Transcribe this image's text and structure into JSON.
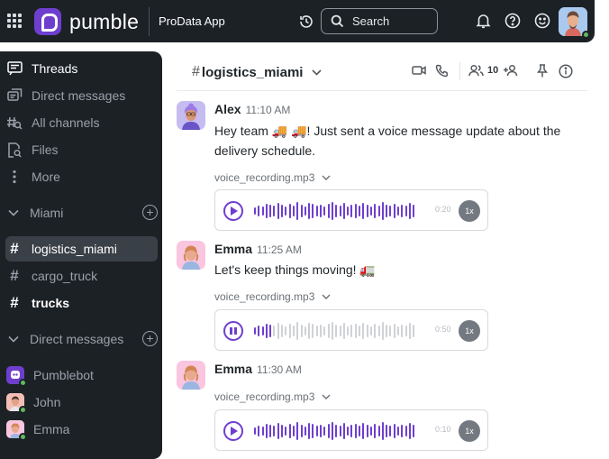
{
  "topbar": {
    "brand": "pumble",
    "workspace": "ProData App",
    "search_placeholder": "Search"
  },
  "sidebar": {
    "top_items": [
      {
        "label": "Threads",
        "icon": "threads-icon"
      },
      {
        "label": "Direct messages",
        "icon": "direct-messages-icon"
      },
      {
        "label": "All channels",
        "icon": "all-channels-icon"
      },
      {
        "label": "Files",
        "icon": "files-icon"
      },
      {
        "label": "More",
        "icon": "more-icon"
      }
    ],
    "channel_section": "Miami",
    "channels": [
      "logistics_miami",
      "cargo_truck",
      "trucks"
    ],
    "dm_section": "Direct messages",
    "dms": [
      "Pumblebot",
      "John",
      "Emma"
    ]
  },
  "channel": {
    "name": "logistics_miami",
    "member_count": "10"
  },
  "messages": [
    {
      "author": "Alex",
      "time": "11:10 AM",
      "text_line1": "Hey team 🚚 🚚! Just sent a voice message update about the",
      "text_line2": "delivery schedule.",
      "file": "voice_recording.mp3",
      "duration": "0:20",
      "speed": "1x",
      "state": "paused",
      "progress": 0
    },
    {
      "author": "Emma",
      "time": "11:25 AM",
      "text_line1": "Let's keep things moving! 🚛",
      "file": "voice_recording.mp3",
      "duration": "0:50",
      "speed": "1x",
      "state": "playing",
      "progress": 0.13
    },
    {
      "author": "Emma",
      "time": "11:30 AM",
      "file": "voice_recording.mp3",
      "duration": "0:10",
      "speed": "1x",
      "state": "paused",
      "progress": 0
    }
  ],
  "colors": {
    "brand": "#6e3fce",
    "dark_bg": "#1c2126",
    "online": "#62b95f",
    "waveform_unplayed": "#cfd2d6"
  }
}
